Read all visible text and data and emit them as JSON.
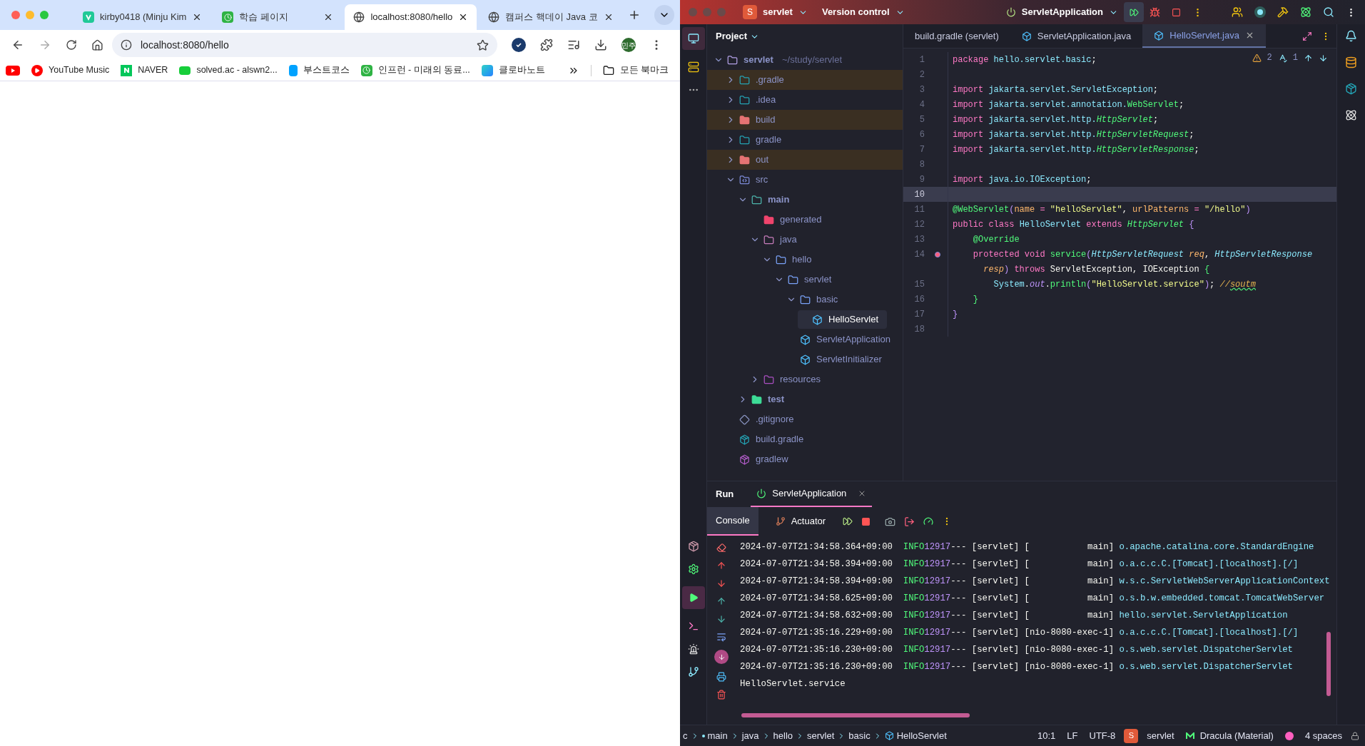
{
  "browser": {
    "tabs": [
      {
        "title": "kirby0418 (Minju Kim",
        "kind": "velog",
        "selected": false
      },
      {
        "title": "학습 페이지",
        "kind": "clock",
        "selected": false
      },
      {
        "title": "localhost:8080/hello",
        "kind": "globe",
        "selected": true
      },
      {
        "title": "캠퍼스 핵데이 Java 코",
        "kind": "globe",
        "selected": false
      }
    ],
    "address": "localhost:8080/hello",
    "avatar": "민주",
    "bookmarks": [
      {
        "kind": "youtube"
      },
      {
        "label": "YouTube Music",
        "kind": "ytmusic"
      },
      {
        "label": "NAVER",
        "kind": "naver"
      },
      {
        "label": "solved.ac - alswn2...",
        "kind": "solved"
      },
      {
        "label": "부스트코스",
        "kind": "boost"
      },
      {
        "label": "인프런 - 미래의 동료...",
        "kind": "clock"
      },
      {
        "label": "클로바노트",
        "kind": "clova"
      }
    ],
    "all_bookmarks": "모든 북마크"
  },
  "ide": {
    "project_badge": "S",
    "project": "servlet",
    "vcs": "Version control",
    "run_config": "ServletApplication",
    "panel_title": "Project",
    "tree": [
      {
        "label": "servlet",
        "path": "~/study/servlet",
        "kind": "module",
        "bold": true,
        "expanded": true,
        "children": [
          {
            "label": ".gradle",
            "kind": "excluded-gradle",
            "bold": false,
            "expanded": false
          },
          {
            "label": ".idea",
            "kind": "idea",
            "bold": false,
            "expanded": false
          },
          {
            "label": "build",
            "kind": "excluded",
            "bold": false,
            "expanded": false
          },
          {
            "label": "gradle",
            "kind": "gradle-folder",
            "bold": false,
            "expanded": false
          },
          {
            "label": "out",
            "kind": "excluded",
            "bold": false,
            "expanded": false
          },
          {
            "label": "src",
            "kind": "source",
            "bold": false,
            "expanded": true,
            "children": [
              {
                "label": "main",
                "kind": "main",
                "bold": true,
                "expanded": true,
                "children": [
                  {
                    "label": "generated",
                    "kind": "generated",
                    "bold": false
                  },
                  {
                    "label": "java",
                    "kind": "java",
                    "bold": false,
                    "expanded": true,
                    "children": [
                      {
                        "label": "hello",
                        "kind": "package",
                        "bold": false,
                        "expanded": true,
                        "children": [
                          {
                            "label": "servlet",
                            "kind": "package",
                            "bold": false,
                            "expanded": true,
                            "children": [
                              {
                                "label": "basic",
                                "kind": "package",
                                "bold": false,
                                "expanded": true,
                                "children": [
                                  {
                                    "label": "HelloServlet",
                                    "kind": "class",
                                    "bold": false,
                                    "selected": true
                                  }
                                ]
                              },
                              {
                                "label": "ServletApplication",
                                "kind": "app-class",
                                "bold": false,
                                "selected": false
                              },
                              {
                                "label": "ServletInitializer",
                                "kind": "class",
                                "bold": false,
                                "selected": false
                              }
                            ]
                          }
                        ]
                      }
                    ]
                  },
                  {
                    "label": "resources",
                    "kind": "resources",
                    "bold": false,
                    "expanded": false
                  }
                ]
              },
              {
                "label": "test",
                "kind": "test",
                "bold": true,
                "expanded": false
              }
            ]
          },
          {
            "label": ".gitignore",
            "kind": "git",
            "bold": false
          },
          {
            "label": "build.gradle",
            "kind": "gradle-file",
            "bold": false
          },
          {
            "label": "gradlew",
            "kind": "gradlew",
            "bold": false
          }
        ]
      }
    ],
    "editor_tabs": [
      {
        "title": "build.gradle (servlet)",
        "kind": "gradle",
        "selected": false
      },
      {
        "title": "ServletApplication.java",
        "kind": "app-class",
        "selected": false
      },
      {
        "title": "HelloServlet.java",
        "kind": "class",
        "selected": true
      }
    ],
    "warnings": "2",
    "typos": "1",
    "lines": [
      {
        "number": "1",
        "current": false,
        "marker": false,
        "tokens": [
          {
            "text": "package ",
            "kind": "kw"
          },
          {
            "text": "hello.servlet.basic",
            "kind": "pkg"
          },
          {
            "text": ";",
            "kind": "plain"
          }
        ]
      },
      {
        "number": "2",
        "current": false,
        "marker": false
      },
      {
        "number": "3",
        "current": false,
        "marker": false,
        "tokens": [
          {
            "text": "import ",
            "kind": "kw"
          },
          {
            "text": "jakarta.servlet.ServletException",
            "kind": "pkg"
          },
          {
            "text": ";",
            "kind": "plain"
          }
        ]
      },
      {
        "number": "4",
        "current": false,
        "marker": false,
        "tokens": [
          {
            "text": "import ",
            "kind": "kw"
          },
          {
            "text": "jakarta.servlet.annotation.",
            "kind": "pkg"
          },
          {
            "text": "WebServlet",
            "kind": "cls"
          },
          {
            "text": ";",
            "kind": "plain"
          }
        ]
      },
      {
        "number": "5",
        "current": false,
        "marker": false,
        "tokens": [
          {
            "text": "import ",
            "kind": "kw"
          },
          {
            "text": "jakarta.servlet.http.",
            "kind": "pkg"
          },
          {
            "text": "HttpServlet",
            "kind": "icls"
          },
          {
            "text": ";",
            "kind": "plain"
          }
        ]
      },
      {
        "number": "6",
        "current": false,
        "marker": false,
        "tokens": [
          {
            "text": "import ",
            "kind": "kw"
          },
          {
            "text": "jakarta.servlet.http.",
            "kind": "pkg"
          },
          {
            "text": "HttpServletRequest",
            "kind": "icls"
          },
          {
            "text": ";",
            "kind": "plain"
          }
        ]
      },
      {
        "number": "7",
        "current": false,
        "marker": false,
        "tokens": [
          {
            "text": "import ",
            "kind": "kw"
          },
          {
            "text": "jakarta.servlet.http.",
            "kind": "pkg"
          },
          {
            "text": "HttpServletResponse",
            "kind": "icls"
          },
          {
            "text": ";",
            "kind": "plain"
          }
        ]
      },
      {
        "number": "8",
        "current": false,
        "marker": false
      },
      {
        "number": "9",
        "current": false,
        "marker": false,
        "tokens": [
          {
            "text": "import ",
            "kind": "kw"
          },
          {
            "text": "java.io.IOException",
            "kind": "pkg"
          },
          {
            "text": ";",
            "kind": "plain"
          }
        ]
      },
      {
        "number": "10",
        "current": true,
        "marker": false
      },
      {
        "number": "11",
        "current": false,
        "marker": false,
        "tokens": [
          {
            "text": "@WebServlet",
            "kind": "cls"
          },
          {
            "text": "(",
            "kind": "brace1"
          },
          {
            "text": "name",
            "kind": "attr"
          },
          {
            "text": " = ",
            "kind": "kw"
          },
          {
            "text": "\"helloServlet\"",
            "kind": "str"
          },
          {
            "text": ", ",
            "kind": "plain"
          },
          {
            "text": "urlPatterns",
            "kind": "attr"
          },
          {
            "text": " = ",
            "kind": "kw"
          },
          {
            "text": "\"/hello\"",
            "kind": "str"
          },
          {
            "text": ")",
            "kind": "brace1"
          }
        ]
      },
      {
        "number": "12",
        "current": false,
        "marker": false,
        "tokens": [
          {
            "text": "public class ",
            "kind": "kw"
          },
          {
            "text": "HelloServlet",
            "kind": "pkg"
          },
          {
            "text": " extends ",
            "kind": "kw"
          },
          {
            "text": "HttpServlet",
            "kind": "icls"
          },
          {
            "text": " {",
            "kind": "brace1"
          }
        ]
      },
      {
        "number": "13",
        "current": false,
        "marker": false,
        "tokens": [
          {
            "text": "    @Override",
            "kind": "cls"
          }
        ]
      },
      {
        "number": "14",
        "current": false,
        "marker": true,
        "tokens": [
          {
            "text": "    protected void ",
            "kind": "kw"
          },
          {
            "text": "service",
            "kind": "cls"
          },
          {
            "text": "(",
            "kind": "brace1"
          },
          {
            "text": "HttpServletRequest",
            "kind": "itype"
          },
          {
            "text": " req",
            "kind": "param"
          },
          {
            "text": ", ",
            "kind": "plain"
          },
          {
            "text": "HttpServletResponse",
            "kind": "itype"
          }
        ]
      },
      {
        "current": false,
        "marker": false,
        "tokens": [
          {
            "text": "      resp",
            "kind": "param"
          },
          {
            "text": ")",
            "kind": "brace1"
          },
          {
            "text": " throws ",
            "kind": "kw"
          },
          {
            "text": "ServletException, IOException ",
            "kind": "plain"
          },
          {
            "text": "{",
            "kind": "brace2"
          }
        ]
      },
      {
        "number": "15",
        "current": false,
        "marker": false,
        "tokens": [
          {
            "text": "        System",
            "kind": "pkg"
          },
          {
            "text": ".",
            "kind": "plain"
          },
          {
            "text": "out",
            "kind": "ifield"
          },
          {
            "text": ".",
            "kind": "plain"
          },
          {
            "text": "println",
            "kind": "cls"
          },
          {
            "text": "(",
            "kind": "brace1"
          },
          {
            "text": "\"HelloServlet.service\"",
            "kind": "str"
          },
          {
            "text": ")",
            "kind": "brace1"
          },
          {
            "text": "; ",
            "kind": "plain"
          },
          {
            "text": "//",
            "kind": "comment"
          },
          {
            "text": "soutm",
            "kind": "typo"
          }
        ]
      },
      {
        "number": "16",
        "current": false,
        "marker": false,
        "tokens": [
          {
            "text": "    }",
            "kind": "brace2"
          }
        ]
      },
      {
        "number": "17",
        "current": false,
        "marker": false,
        "tokens": [
          {
            "text": "}",
            "kind": "brace1"
          }
        ]
      },
      {
        "number": "18",
        "current": false,
        "marker": false
      }
    ],
    "run": {
      "title": "Run",
      "tab": "ServletApplication",
      "subtabs": [
        {
          "label": "Console",
          "kind": "console",
          "selected": true
        },
        {
          "label": "Actuator",
          "kind": "actuator",
          "selected": false
        }
      ],
      "log": [
        {
          "kind": "log",
          "time": "2024-07-07T21:34:58.364+09:00",
          "level": "INFO",
          "pid": "12917",
          "sep": "---",
          "app": "[servlet]",
          "thread": "[           main]",
          "logger": "o.apache.catalina.core.StandardEngine"
        },
        {
          "kind": "log",
          "time": "2024-07-07T21:34:58.394+09:00",
          "level": "INFO",
          "pid": "12917",
          "sep": "---",
          "app": "[servlet]",
          "thread": "[           main]",
          "logger": "o.a.c.c.C.[Tomcat].[localhost].[/]"
        },
        {
          "kind": "log",
          "time": "2024-07-07T21:34:58.394+09:00",
          "level": "INFO",
          "pid": "12917",
          "sep": "---",
          "app": "[servlet]",
          "thread": "[           main]",
          "logger": "w.s.c.ServletWebServerApplicationContext"
        },
        {
          "kind": "log",
          "time": "2024-07-07T21:34:58.625+09:00",
          "level": "INFO",
          "pid": "12917",
          "sep": "---",
          "app": "[servlet]",
          "thread": "[           main]",
          "logger": "o.s.b.w.embedded.tomcat.TomcatWebServer"
        },
        {
          "kind": "log",
          "time": "2024-07-07T21:34:58.632+09:00",
          "level": "INFO",
          "pid": "12917",
          "sep": "---",
          "app": "[servlet]",
          "thread": "[           main]",
          "logger": "hello.servlet.ServletApplication"
        },
        {
          "kind": "log",
          "time": "2024-07-07T21:35:16.229+09:00",
          "level": "INFO",
          "pid": "12917",
          "sep": "---",
          "app": "[servlet]",
          "thread": "[nio-8080-exec-1]",
          "logger": "o.a.c.c.C.[Tomcat].[localhost].[/]"
        },
        {
          "kind": "log",
          "time": "2024-07-07T21:35:16.230+09:00",
          "level": "INFO",
          "pid": "12917",
          "sep": "---",
          "app": "[servlet]",
          "thread": "[nio-8080-exec-1]",
          "logger": "o.s.web.servlet.DispatcherServlet"
        },
        {
          "kind": "log",
          "time": "2024-07-07T21:35:16.230+09:00",
          "level": "INFO",
          "pid": "12917",
          "sep": "---",
          "app": "[servlet]",
          "thread": "[nio-8080-exec-1]",
          "logger": "o.s.web.servlet.DispatcherServlet"
        },
        {
          "kind": "out",
          "text": "HelloServlet.service"
        }
      ]
    },
    "status": {
      "breadcrumbs": [
        {
          "label": "c",
          "kind": "cut"
        },
        {
          "label": "main",
          "kind": "module"
        },
        {
          "label": "java",
          "kind": "plain"
        },
        {
          "label": "hello",
          "kind": "plain"
        },
        {
          "label": "servlet",
          "kind": "plain"
        },
        {
          "label": "basic",
          "kind": "plain"
        },
        {
          "label": "HelloServlet",
          "kind": "class"
        }
      ],
      "position": "10:1",
      "line_sep": "LF",
      "encoding": "UTF-8",
      "project_badge": "S",
      "project": "servlet",
      "theme": "Dracula (Material)",
      "indent": "4 spaces"
    }
  }
}
